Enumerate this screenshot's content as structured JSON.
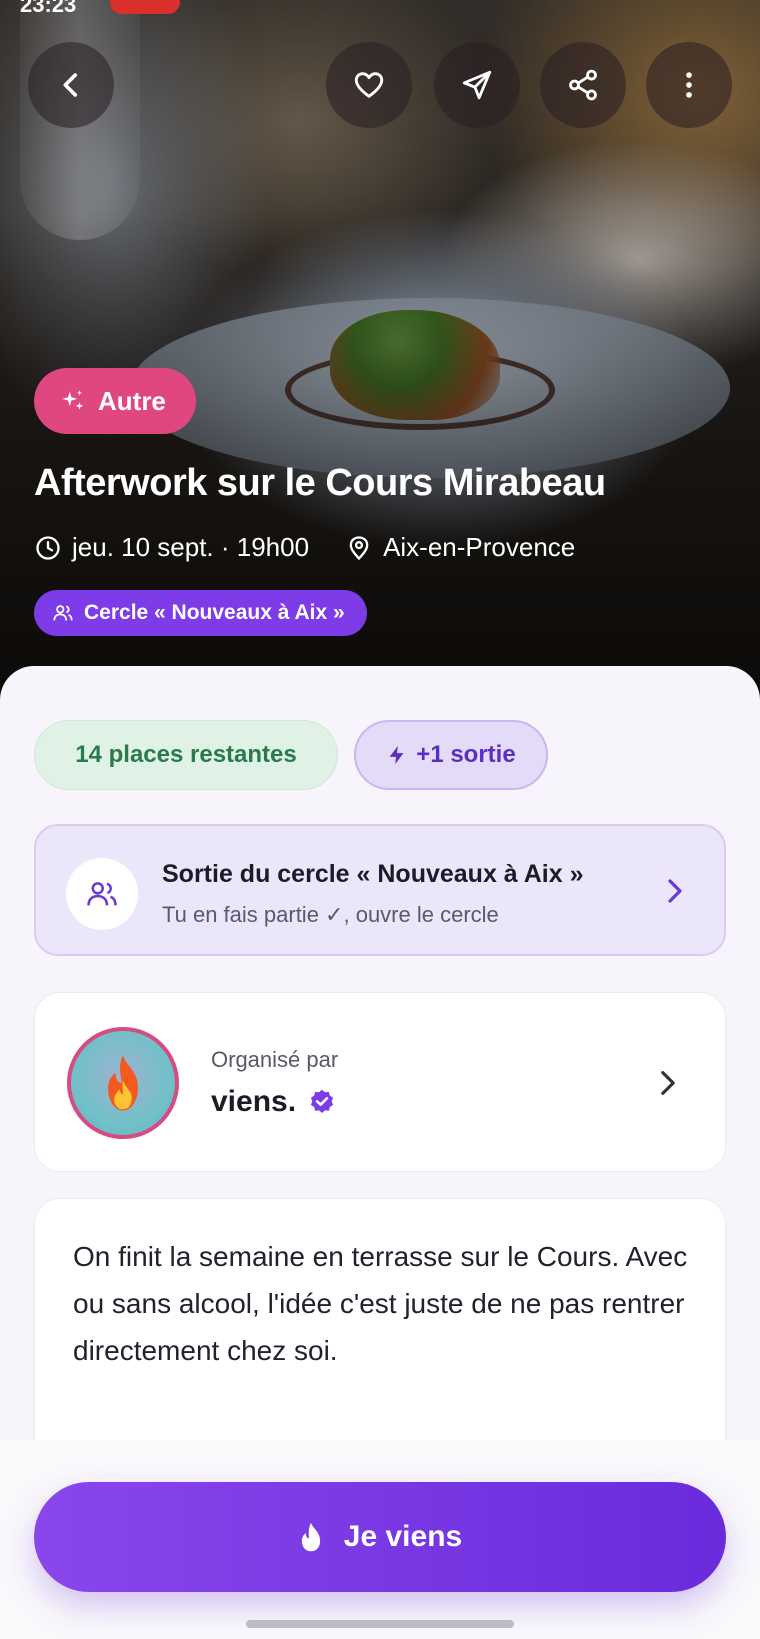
{
  "status_bar": {
    "time": "23:23"
  },
  "hero": {
    "category": "Autre",
    "title": "Afterwork sur le Cours Mirabeau",
    "date_time": "jeu. 10 sept. · 19h00",
    "location": "Aix-en-Provence",
    "circle_chip": "Cercle « Nouveaux à Aix »"
  },
  "top_actions": {
    "back_icon": "chevron-left-icon",
    "like_icon": "heart-icon",
    "send_icon": "paper-plane-icon",
    "share_icon": "share-icon",
    "more_icon": "more-vertical-icon"
  },
  "pills": {
    "places": "14 places restantes",
    "sortie": "+1 sortie"
  },
  "circle_card": {
    "title": "Sortie du cercle « Nouveaux à Aix »",
    "subtitle": "Tu en fais partie ✓, ouvre le cercle"
  },
  "organizer": {
    "label": "Organisé par",
    "name": "viens."
  },
  "description": {
    "text": "On finit la semaine en terrasse sur le Cours. Avec ou sans alcool, l'idée c'est juste de ne pas rentrer directement chez soi."
  },
  "cta": {
    "label": "Je viens"
  },
  "colors": {
    "accent": "#7d3ce8",
    "category_pink": "#e0467f",
    "places_green": "#2b7a4b",
    "cta_start": "#8a46ec",
    "cta_end": "#6a2bdc"
  }
}
